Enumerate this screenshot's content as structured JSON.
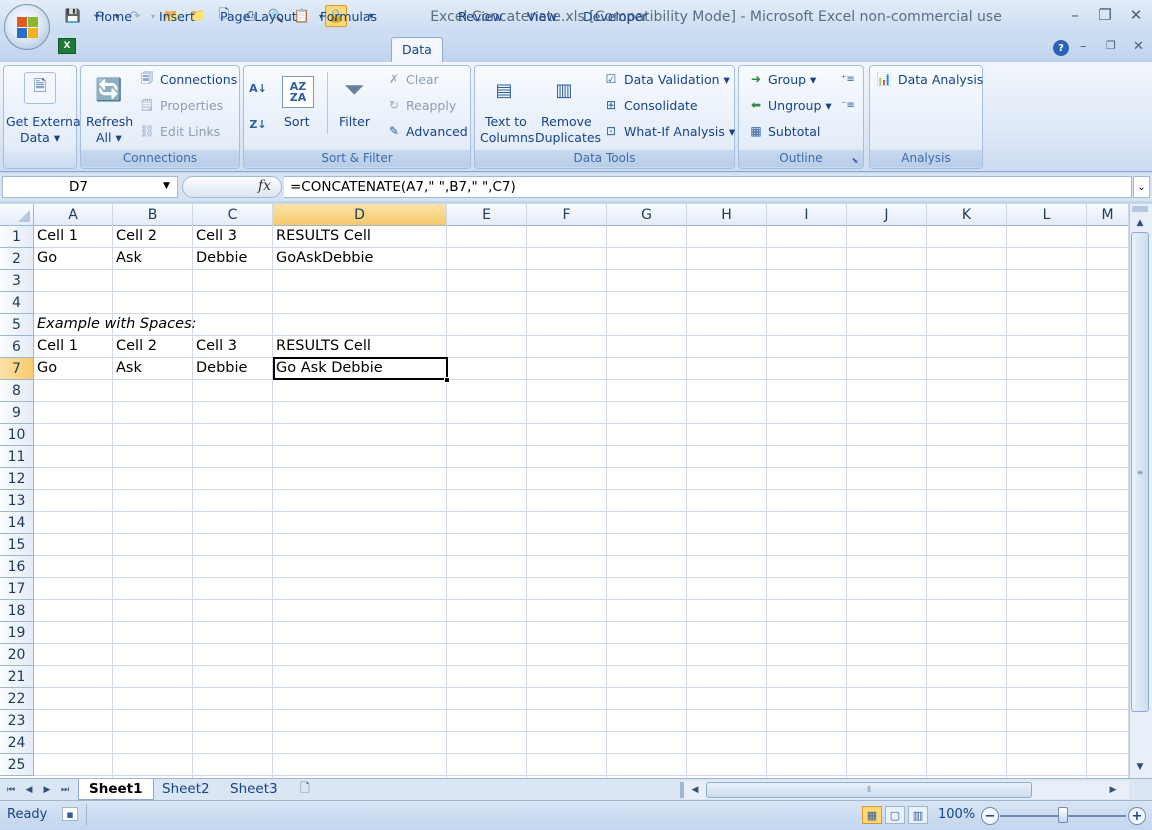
{
  "window": {
    "title": "Excel Concatenate.xls  [Compatibility Mode] - Microsoft Excel non-commercial use",
    "minimize": "–",
    "restore": "❐",
    "close": "✕"
  },
  "ribbon_tabs": [
    "Home",
    "Insert",
    "Page Layout",
    "Formulas",
    "Data",
    "Review",
    "View",
    "Developer"
  ],
  "active_tab": "Data",
  "ribbon": {
    "get_external_data": {
      "line1": "Get External",
      "line2": "Data ▾",
      "group": ""
    },
    "connections": {
      "refresh_line1": "Refresh",
      "refresh_line2": "All ▾",
      "connections": "Connections",
      "properties": "Properties",
      "edit_links": "Edit Links",
      "group": "Connections"
    },
    "sort_filter": {
      "sort": "Sort",
      "filter": "Filter",
      "clear": "Clear",
      "reapply": "Reapply",
      "advanced": "Advanced",
      "group": "Sort & Filter"
    },
    "data_tools": {
      "text_to_line1": "Text to",
      "text_to_line2": "Columns",
      "remove_line1": "Remove",
      "remove_line2": "Duplicates",
      "data_validation": "Data Validation ▾",
      "consolidate": "Consolidate",
      "what_if": "What-If Analysis ▾",
      "group": "Data Tools"
    },
    "outline": {
      "group_btn": "Group ▾",
      "ungroup_btn": "Ungroup ▾",
      "subtotal": "Subtotal",
      "group": "Outline"
    },
    "analysis": {
      "data_analysis": "Data Analysis",
      "group": "Analysis"
    }
  },
  "formula_bar": {
    "name_box": "D7",
    "fx": "fx",
    "formula": "=CONCATENATE(A7,\" \",B7,\" \",C7)"
  },
  "columns": [
    "A",
    "B",
    "C",
    "D",
    "E",
    "F",
    "G",
    "H",
    "I",
    "J",
    "K",
    "L",
    "M"
  ],
  "selected_column": "D",
  "rows": [
    "1",
    "2",
    "3",
    "4",
    "5",
    "6",
    "7",
    "8",
    "9",
    "10",
    "11",
    "12",
    "13",
    "14",
    "15",
    "16",
    "17",
    "18",
    "19",
    "20",
    "21",
    "22",
    "23",
    "24",
    "25"
  ],
  "selected_row": "7",
  "cells": {
    "A1": "Cell 1",
    "B1": "Cell 2",
    "C1": "Cell 3",
    "D1": "RESULTS Cell",
    "A2": "Go",
    "B2": "Ask",
    "C2": "Debbie",
    "D2": "GoAskDebbie",
    "A5": "Example with Spaces:",
    "A6": "Cell 1",
    "B6": "Cell 2",
    "C6": "Cell 3",
    "D6": "RESULTS Cell",
    "A7": "Go",
    "B7": "Ask",
    "C7": "Debbie",
    "D7": "Go Ask Debbie"
  },
  "active_cell": "D7",
  "sheet_tabs": [
    "Sheet1",
    "Sheet2",
    "Sheet3"
  ],
  "active_sheet": "Sheet1",
  "status": {
    "text": "Ready",
    "zoom": "100%",
    "zoom_minus": "−",
    "zoom_plus": "+"
  },
  "colors": {
    "selected_header": "#f7c96c",
    "ribbon_text": "#15428b",
    "grid_line": "#d0d7e5"
  }
}
